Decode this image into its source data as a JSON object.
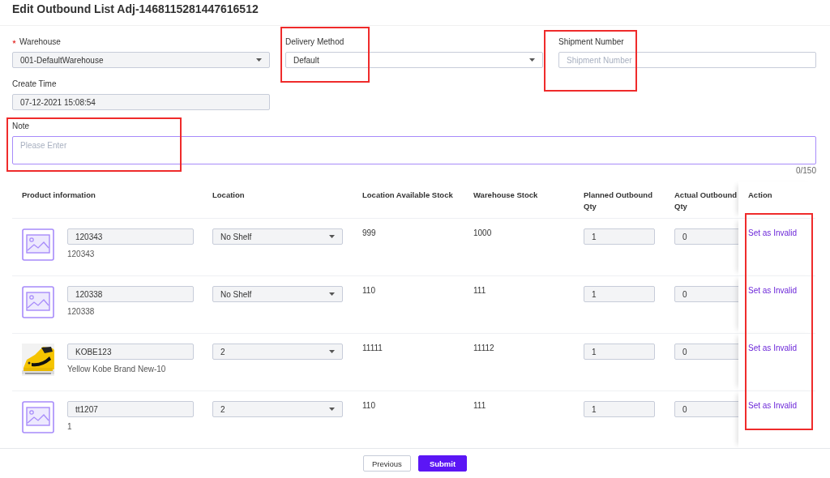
{
  "title": "Edit Outbound List Adj-1468115281447616512",
  "form": {
    "warehouse": {
      "label": "Warehouse",
      "required": true,
      "kind": "select",
      "value": "001-DefaultWarehouse",
      "disabled": true
    },
    "delivery_method": {
      "label": "Delivery Method",
      "kind": "select",
      "value": "Default",
      "disabled": false,
      "highlighted": true
    },
    "shipment_number": {
      "label": "Shipment Number",
      "kind": "input",
      "placeholder": "Shipment Number",
      "disabled": false,
      "highlighted": true
    },
    "create_time": {
      "label": "Create Time",
      "kind": "input",
      "value": "07-12-2021 15:08:54",
      "disabled": true
    },
    "note": {
      "label": "Note",
      "kind": "textarea",
      "placeholder": "Please Enter",
      "counter": "0/150",
      "highlighted": true
    }
  },
  "table": {
    "columns": [
      "Product information",
      "Location",
      "Location Available Stock",
      "Warehouse Stock",
      "Planned Outbound Qty",
      "Actual Outbound Qty",
      "Action"
    ],
    "action_highlighted": true,
    "rows": [
      {
        "kind": "placeholder",
        "code": "120343",
        "name": "120343",
        "location": "No Shelf",
        "location_available_stock": "999",
        "warehouse_stock": "1000",
        "planned_qty": "1",
        "actual_qty": "0",
        "action": "Set as Invalid"
      },
      {
        "kind": "placeholder",
        "code": "120338",
        "name": "120338",
        "location": "No Shelf",
        "location_available_stock": "110",
        "warehouse_stock": "111",
        "planned_qty": "1",
        "actual_qty": "0",
        "action": "Set as Invalid"
      },
      {
        "kind": "picture",
        "code": "KOBE123",
        "name": "Yellow Kobe Brand New-10",
        "location": "2",
        "location_available_stock": "11111",
        "warehouse_stock": "11112",
        "planned_qty": "1",
        "actual_qty": "0",
        "action": "Set as Invalid"
      },
      {
        "kind": "placeholder",
        "code": "tt1207",
        "name": "1",
        "location": "2",
        "location_available_stock": "110",
        "warehouse_stock": "111",
        "planned_qty": "1",
        "actual_qty": "0",
        "action": "Set as Invalid"
      }
    ]
  },
  "buttons": [
    {
      "label": "Previous",
      "kind": "secondary"
    },
    {
      "label": "Submit",
      "kind": "primary"
    }
  ]
}
